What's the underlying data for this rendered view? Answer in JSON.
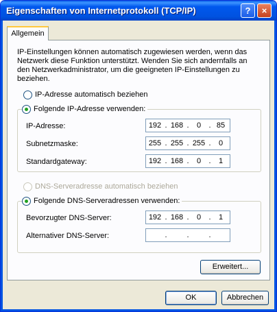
{
  "window": {
    "title": "Eigenschaften von Internetprotokoll (TCP/IP)",
    "help_label": "?",
    "close_label": "×"
  },
  "tab": {
    "label": "Allgemein"
  },
  "description": "IP-Einstellungen können automatisch zugewiesen werden, wenn das Netzwerk diese Funktion unterstützt. Wenden Sie sich andernfalls an den Netzwerkadministrator, um die geeigneten IP-Einstellungen zu beziehen.",
  "ip_mode": {
    "auto_label": "IP-Adresse automatisch beziehen",
    "manual_label": "Folgende IP-Adresse verwenden:",
    "selected": "manual"
  },
  "ip_fields": {
    "ip": {
      "label": "IP-Adresse:",
      "octets": [
        "192",
        "168",
        "0",
        "85"
      ]
    },
    "mask": {
      "label": "Subnetzmaske:",
      "octets": [
        "255",
        "255",
        "255",
        "0"
      ]
    },
    "gateway": {
      "label": "Standardgateway:",
      "octets": [
        "192",
        "168",
        "0",
        "1"
      ]
    }
  },
  "dns_mode": {
    "auto_label": "DNS-Serveradresse automatisch beziehen",
    "manual_label": "Folgende DNS-Serveradressen verwenden:",
    "auto_disabled": true,
    "selected": "manual"
  },
  "dns_fields": {
    "preferred": {
      "label": "Bevorzugter DNS-Server:",
      "octets": [
        "192",
        "168",
        "0",
        "1"
      ]
    },
    "alternate": {
      "label": "Alternativer DNS-Server:",
      "octets": [
        "",
        "",
        "",
        ""
      ]
    }
  },
  "buttons": {
    "advanced": "Erweitert...",
    "ok": "OK",
    "cancel": "Abbrechen"
  },
  "colors": {
    "titlebar": "#0054e3",
    "dialog_bg": "#ece9d8",
    "panel_bg": "#fcfcfe",
    "tab_highlight": "#ffc83c",
    "radio_dot": "#21a121"
  }
}
